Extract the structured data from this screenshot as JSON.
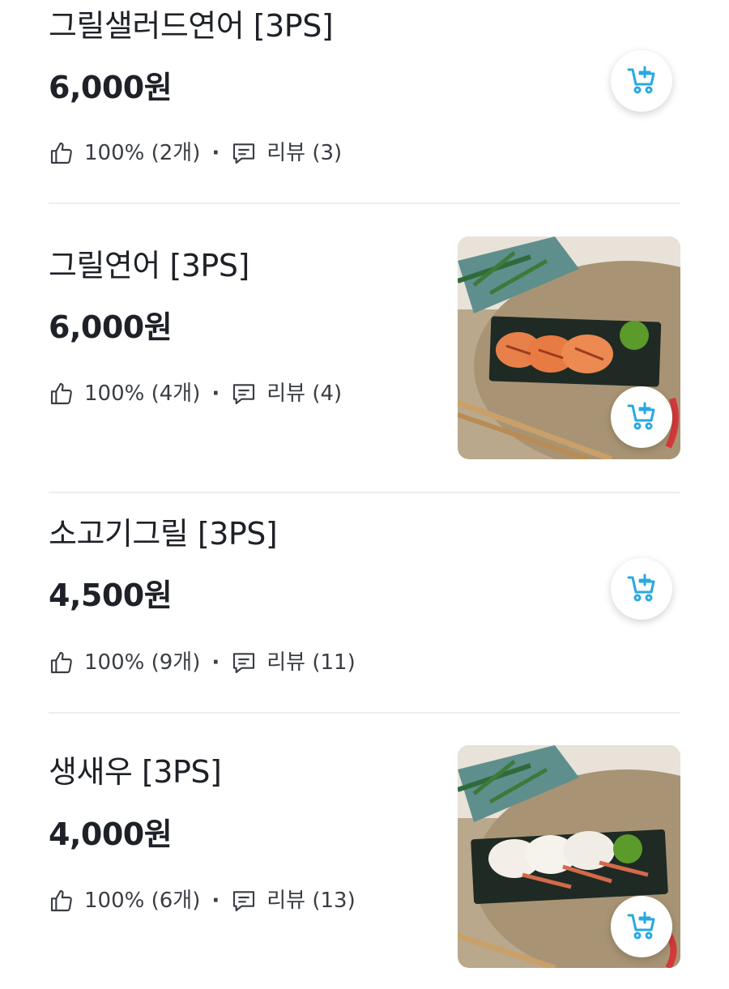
{
  "items": [
    {
      "name": "그릴샐러드연어 [3PS]",
      "price": "6,000원",
      "rating": "100% (2개)",
      "review": "리뷰 (3)",
      "has_image": false
    },
    {
      "name": "그릴연어 [3PS]",
      "price": "6,000원",
      "rating": "100% (4개)",
      "review": "리뷰 (4)",
      "has_image": true,
      "image_desc": "grilled-salmon-sushi-photo"
    },
    {
      "name": "소고기그릴 [3PS]",
      "price": "4,500원",
      "rating": "100% (9개)",
      "review": "리뷰 (11)",
      "has_image": false
    },
    {
      "name": "생새우 [3PS]",
      "price": "4,000원",
      "rating": "100% (6개)",
      "review": "리뷰 (13)",
      "has_image": true,
      "image_desc": "raw-shrimp-sushi-photo"
    }
  ],
  "icons": {
    "thumbs_up": "thumbs-up-icon",
    "review": "comment-icon",
    "cart": "cart-add-icon"
  },
  "colors": {
    "text": "#1e2127",
    "meta_text": "#3a3d44",
    "accent": "#29a8e0",
    "divider": "#eceef1"
  }
}
